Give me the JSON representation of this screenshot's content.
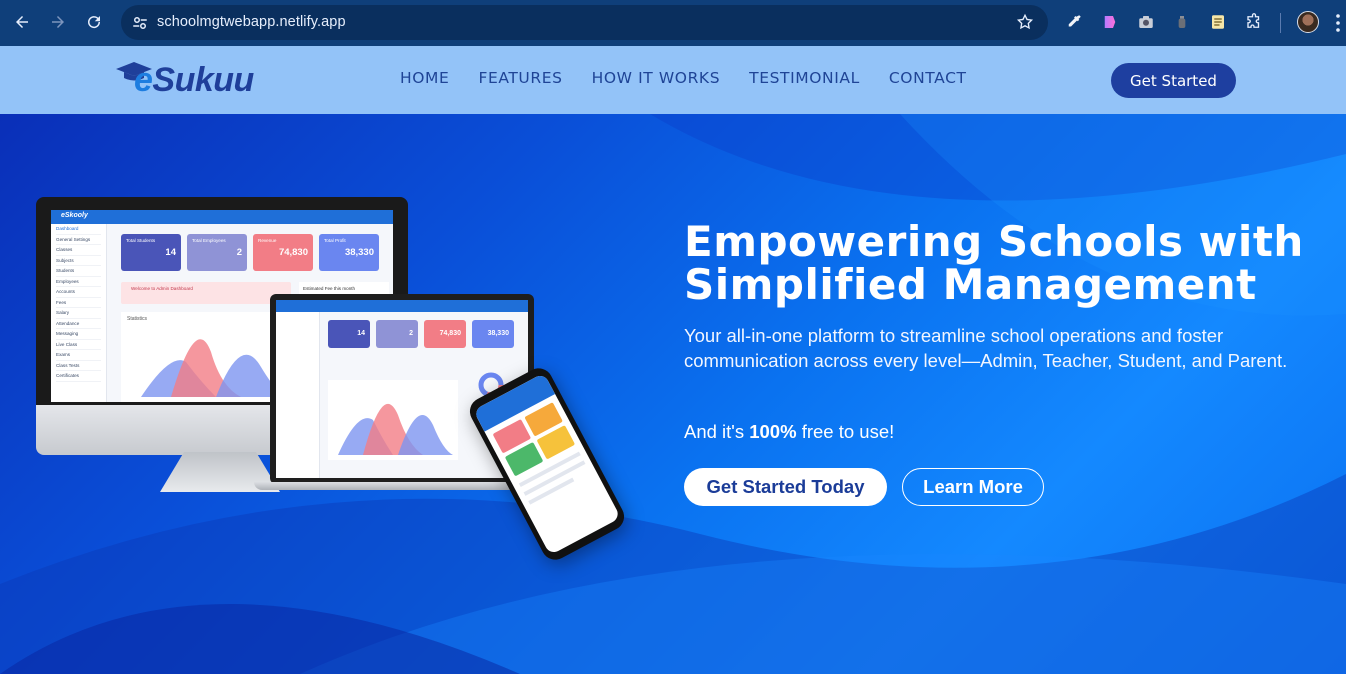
{
  "browser": {
    "url": "schoolmgtwebapp.netlify.app"
  },
  "header": {
    "logo_text_e": "e",
    "logo_text_rest": "Sukuu",
    "nav": [
      "HOME",
      "FEATURES",
      "HOW IT WORKS",
      "TESTIMONIAL",
      "CONTACT"
    ],
    "cta_label": "Get Started"
  },
  "hero": {
    "title_line1": "Empowering Schools with",
    "title_line2": "Simplified Management",
    "subtitle": "Your all-in-one platform to streamline school operations and foster communication across every level—Admin, Teacher, Student, and Parent.",
    "free_prefix": "And it's ",
    "free_bold": "100%",
    "free_suffix": " free to use!",
    "primary_btn": "Get Started Today",
    "secondary_btn": "Learn More"
  },
  "mockup": {
    "dashboard_logo": "eSkooly",
    "sidebar": [
      "Dashboard",
      "General Settings",
      "Classes",
      "Subjects",
      "Students",
      "Employees",
      "Accounts",
      "Fees",
      "Salary",
      "Attendance",
      "Messaging",
      "Live Class",
      "Exams",
      "Class Tests",
      "Certificates"
    ],
    "cards": [
      {
        "title": "Total Students",
        "value": "14",
        "color": "#4a55b8"
      },
      {
        "title": "Total Employees",
        "value": "2",
        "color": "#8f93d6"
      },
      {
        "title": "Revenue",
        "value": "74,830",
        "color": "#f27d86"
      },
      {
        "title": "Total Profit",
        "value": "38,330",
        "color": "#6a86f0"
      }
    ],
    "welcome": "Welcome to Admin Dashboard",
    "stats_label": "Statistics",
    "estimated_label": "Estimated Fee this month"
  },
  "colors": {
    "header_bg": "#93c3f8",
    "brand_navy": "#1e3fa0",
    "hero_blue": "#0a6ff0"
  }
}
